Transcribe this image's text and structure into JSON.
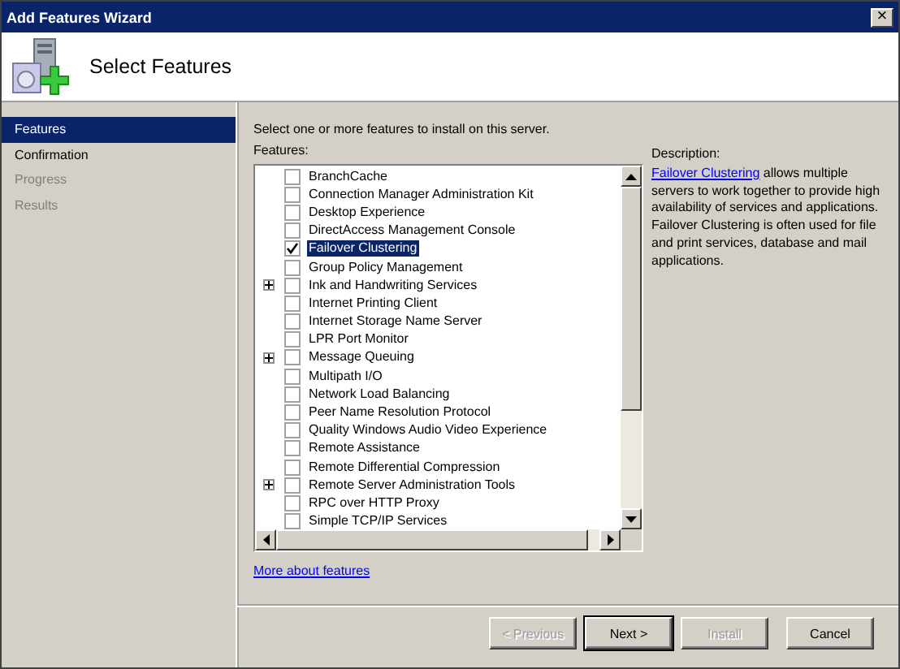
{
  "window": {
    "title": "Add Features Wizard",
    "close": "×"
  },
  "header": {
    "title": "Select Features"
  },
  "nav": [
    {
      "label": "Features",
      "selected": true,
      "disabled": false
    },
    {
      "label": "Confirmation",
      "selected": false,
      "disabled": false
    },
    {
      "label": "Progress",
      "selected": false,
      "disabled": true
    },
    {
      "label": "Results",
      "selected": false,
      "disabled": true
    }
  ],
  "instruction": "Select one or more features to install on this server.",
  "features_label": "Features:",
  "features": [
    {
      "label": "BranchCache",
      "checked": false,
      "expandable": false,
      "selected": false
    },
    {
      "label": "Connection Manager Administration Kit",
      "checked": false,
      "expandable": false,
      "selected": false
    },
    {
      "label": "Desktop Experience",
      "checked": false,
      "expandable": false,
      "selected": false
    },
    {
      "label": "DirectAccess Management Console",
      "checked": false,
      "expandable": false,
      "selected": false
    },
    {
      "label": "Failover Clustering",
      "checked": true,
      "expandable": false,
      "selected": true
    },
    {
      "label": "Group Policy Management",
      "checked": false,
      "expandable": false,
      "selected": false
    },
    {
      "label": "Ink and Handwriting Services",
      "checked": false,
      "expandable": true,
      "selected": false
    },
    {
      "label": "Internet Printing Client",
      "checked": false,
      "expandable": false,
      "selected": false
    },
    {
      "label": "Internet Storage Name Server",
      "checked": false,
      "expandable": false,
      "selected": false
    },
    {
      "label": "LPR Port Monitor",
      "checked": false,
      "expandable": false,
      "selected": false
    },
    {
      "label": "Message Queuing",
      "checked": false,
      "expandable": true,
      "selected": false
    },
    {
      "label": "Multipath I/O",
      "checked": false,
      "expandable": false,
      "selected": false
    },
    {
      "label": "Network Load Balancing",
      "checked": false,
      "expandable": false,
      "selected": false
    },
    {
      "label": "Peer Name Resolution Protocol",
      "checked": false,
      "expandable": false,
      "selected": false
    },
    {
      "label": "Quality Windows Audio Video Experience",
      "checked": false,
      "expandable": false,
      "selected": false
    },
    {
      "label": "Remote Assistance",
      "checked": false,
      "expandable": false,
      "selected": false
    },
    {
      "label": "Remote Differential Compression",
      "checked": false,
      "expandable": false,
      "selected": false
    },
    {
      "label": "Remote Server Administration Tools",
      "checked": false,
      "expandable": true,
      "selected": false
    },
    {
      "label": "RPC over HTTP Proxy",
      "checked": false,
      "expandable": false,
      "selected": false
    },
    {
      "label": "Simple TCP/IP Services",
      "checked": false,
      "expandable": false,
      "selected": false
    }
  ],
  "more_link": "More about features",
  "description": {
    "label": "Description:",
    "link": "Failover Clustering",
    "text": "allows multiple servers to work together to provide high availability of services and applications. Failover Clustering is often used for file and print services, database and mail applications."
  },
  "buttons": [
    {
      "label": "< Previous",
      "disabled": true,
      "default": false
    },
    {
      "label": "Next >",
      "disabled": false,
      "default": true
    },
    {
      "label": "Install",
      "disabled": true,
      "default": false
    },
    {
      "label": "Cancel",
      "disabled": false,
      "default": false
    }
  ]
}
